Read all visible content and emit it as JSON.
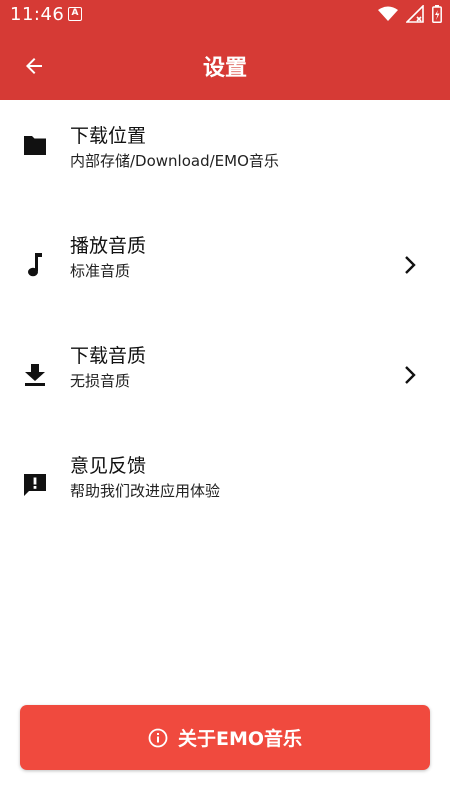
{
  "status_bar": {
    "time": "11:46",
    "indicator": "A"
  },
  "app_bar": {
    "title": "设置",
    "back_icon": "arrow-left-icon"
  },
  "settings": [
    {
      "icon": "folder-icon",
      "title": "下载位置",
      "subtitle": "内部存储/Download/EMO音乐",
      "has_chevron": false
    },
    {
      "icon": "music-note-icon",
      "title": "播放音质",
      "subtitle": "标准音质",
      "has_chevron": true
    },
    {
      "icon": "download-icon",
      "title": "下载音质",
      "subtitle": "无损音质",
      "has_chevron": true
    },
    {
      "icon": "feedback-icon",
      "title": "意见反馈",
      "subtitle": "帮助我们改进应用体验",
      "has_chevron": false
    }
  ],
  "about_button": {
    "label": "关于EMO音乐",
    "icon": "info-icon"
  },
  "colors": {
    "primary": "#d63a35",
    "button": "#f04a3e"
  }
}
